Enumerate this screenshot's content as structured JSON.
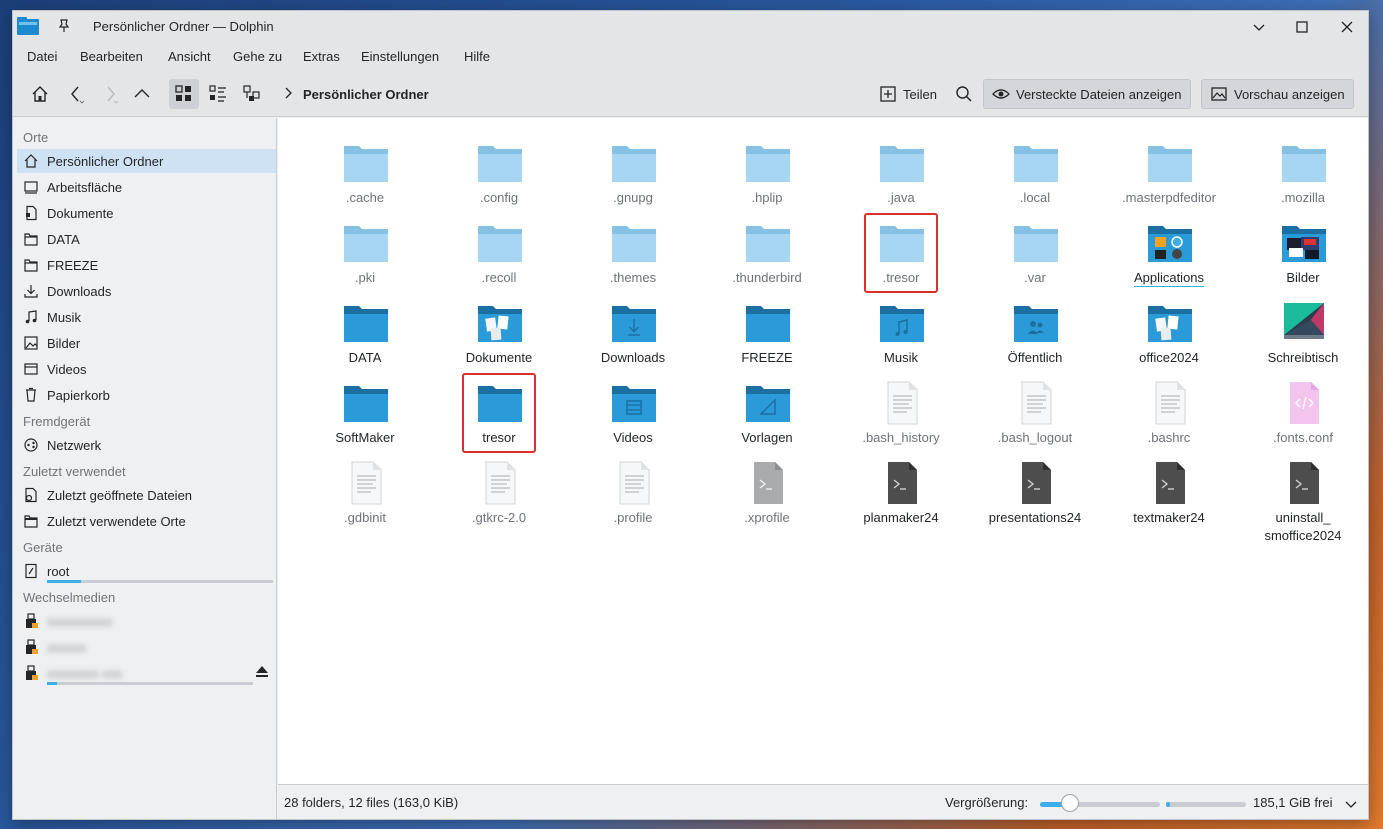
{
  "window": {
    "title": "Persönlicher Ordner — Dolphin"
  },
  "menu": [
    "Datei",
    "Bearbeiten",
    "Ansicht",
    "Gehe zu",
    "Extras",
    "Einstellungen",
    "Hilfe"
  ],
  "toolbar": {
    "breadcrumb": "Persönlicher Ordner",
    "share_label": "Teilen",
    "hidden_files_label": "Versteckte Dateien anzeigen",
    "preview_label": "Vorschau anzeigen"
  },
  "sidebar": {
    "places_title": "Orte",
    "places": [
      {
        "label": "Persönlicher Ordner",
        "icon": "home-icon",
        "selected": true
      },
      {
        "label": "Arbeitsfläche",
        "icon": "desktop-icon"
      },
      {
        "label": "Dokumente",
        "icon": "document-icon"
      },
      {
        "label": "DATA",
        "icon": "folder-icon"
      },
      {
        "label": "FREEZE",
        "icon": "folder-icon"
      },
      {
        "label": "Downloads",
        "icon": "download-icon"
      },
      {
        "label": "Musik",
        "icon": "music-icon"
      },
      {
        "label": "Bilder",
        "icon": "image-icon"
      },
      {
        "label": "Videos",
        "icon": "video-icon"
      },
      {
        "label": "Papierkorb",
        "icon": "trash-icon"
      }
    ],
    "remote_title": "Fremdgerät",
    "remote": [
      {
        "label": "Netzwerk",
        "icon": "network-icon"
      }
    ],
    "recent_title": "Zuletzt verwendet",
    "recent": [
      {
        "label": "Zuletzt geöffnete Dateien",
        "icon": "recent-files-icon"
      },
      {
        "label": "Zuletzt verwendete Orte",
        "icon": "recent-places-icon"
      }
    ],
    "devices_title": "Geräte",
    "devices": [
      {
        "label": "root",
        "icon": "drive-icon",
        "usage": 0.15
      }
    ],
    "removable_title": "Wechselmedien",
    "removable": [
      {
        "label": "xxxxxxxxxx",
        "icon": "usb-icon"
      },
      {
        "label": "xxxxxx",
        "icon": "usb-icon"
      },
      {
        "label": "xxxxxxxx xxx",
        "icon": "usb-icon",
        "usage": 0.05,
        "eject": true
      }
    ]
  },
  "files": [
    {
      "name": ".cache",
      "type": "folder-light"
    },
    {
      "name": ".config",
      "type": "folder-light"
    },
    {
      "name": ".gnupg",
      "type": "folder-light"
    },
    {
      "name": ".hplip",
      "type": "folder-light"
    },
    {
      "name": ".java",
      "type": "folder-light"
    },
    {
      "name": ".local",
      "type": "folder-light"
    },
    {
      "name": ".masterpdfeditor",
      "type": "folder-light"
    },
    {
      "name": ".mozilla",
      "type": "folder-light"
    },
    {
      "name": ".pki",
      "type": "folder-light"
    },
    {
      "name": ".recoll",
      "type": "folder-light"
    },
    {
      "name": ".themes",
      "type": "folder-light"
    },
    {
      "name": ".thunderbird",
      "type": "folder-light"
    },
    {
      "name": ".tresor",
      "type": "folder-light",
      "highlight": true
    },
    {
      "name": ".var",
      "type": "folder-light"
    },
    {
      "name": "Applications",
      "type": "folder-apps"
    },
    {
      "name": "Bilder",
      "type": "folder-pictures"
    },
    {
      "name": "DATA",
      "type": "folder"
    },
    {
      "name": "Dokumente",
      "type": "folder-documents"
    },
    {
      "name": "Downloads",
      "type": "folder-downloads"
    },
    {
      "name": "FREEZE",
      "type": "folder"
    },
    {
      "name": "Musik",
      "type": "folder-music"
    },
    {
      "name": "Öffentlich",
      "type": "folder-public"
    },
    {
      "name": "office2024",
      "type": "folder-documents"
    },
    {
      "name": "Schreibtisch",
      "type": "desktop"
    },
    {
      "name": "SoftMaker",
      "type": "folder"
    },
    {
      "name": "tresor",
      "type": "folder",
      "highlight": true
    },
    {
      "name": "Videos",
      "type": "folder-videos"
    },
    {
      "name": "Vorlagen",
      "type": "folder-templates"
    },
    {
      "name": ".bash_history",
      "type": "text"
    },
    {
      "name": ".bash_logout",
      "type": "text"
    },
    {
      "name": ".bashrc",
      "type": "text"
    },
    {
      "name": ".fonts.conf",
      "type": "xml"
    },
    {
      "name": ".gdbinit",
      "type": "text"
    },
    {
      "name": ".gtkrc-2.0",
      "type": "text"
    },
    {
      "name": ".profile",
      "type": "text"
    },
    {
      "name": ".xprofile",
      "type": "script-light"
    },
    {
      "name": "planmaker24",
      "type": "script"
    },
    {
      "name": "presentations24",
      "type": "script"
    },
    {
      "name": "textmaker24",
      "type": "script"
    },
    {
      "name": "uninstall_\nsmoffice2024",
      "type": "script"
    }
  ],
  "status": {
    "summary": "28 folders, 12 files (163,0 KiB)",
    "zoom_label": "Vergrößerung:",
    "zoom_level": 0.25,
    "free_space": "185,1 GiB frei",
    "free_fraction": 0.05
  },
  "colors": {
    "accent": "#3daee9",
    "folder": "#2a9bd8",
    "folder_light": "#a6d6f2",
    "highlight": "#d9302a"
  }
}
